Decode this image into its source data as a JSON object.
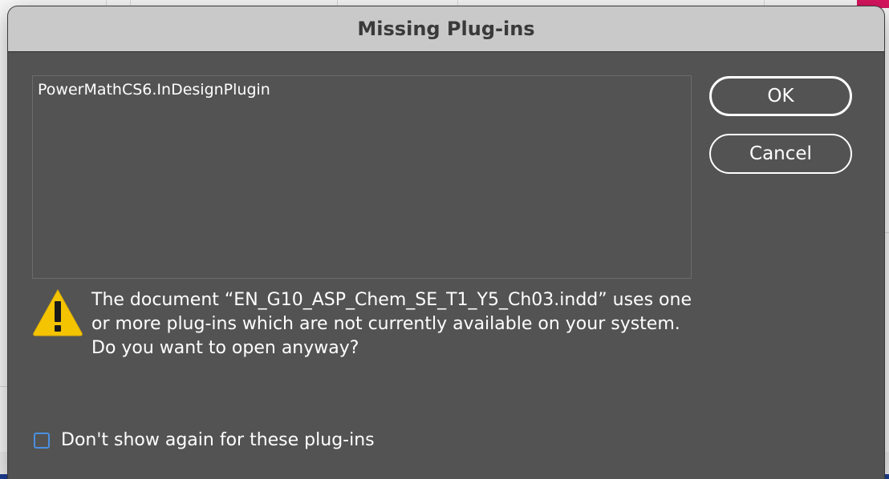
{
  "dialog": {
    "title": "Missing Plug-ins",
    "plugins": [
      "PowerMathCS6.InDesignPlugin"
    ],
    "buttons": {
      "ok": "OK",
      "cancel": "Cancel"
    },
    "warning_icon": "warning-triangle-icon",
    "message": "The document “EN_G10_ASP_Chem_SE_T1_Y5_Ch03.indd” uses one or more plug-ins which are not currently available on your system. Do you want to open anyway?",
    "checkbox": {
      "label": "Don't show again for these plug-ins",
      "checked": false
    }
  },
  "colors": {
    "dialog_bg": "#535353",
    "titlebar_bg": "#c9c9c9",
    "warning_yellow": "#f5c400",
    "checkbox_accent": "#4a90e2"
  }
}
